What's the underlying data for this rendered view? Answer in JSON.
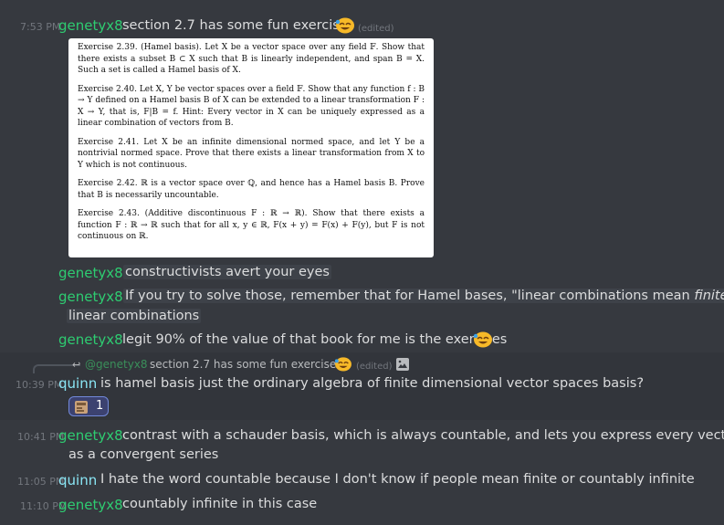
{
  "messages": [
    {
      "time": "7:53 PM",
      "author": "genetyx8",
      "text": "section 2.7 has some fun exercises",
      "edited": "(edited)"
    },
    {
      "author": "genetyx8",
      "text": "constructivists avert your eyes"
    },
    {
      "author": "genetyx8",
      "text_line1_a": "If you try to solve those, remember that for Hamel bases, \"linear combinations mean ",
      "text_line1_em": "finite",
      "text_line2": "linear combinations"
    },
    {
      "author": "genetyx8",
      "text": "legit 90% of the value of that book for me is the exercises"
    },
    {
      "time": "10:39 PM",
      "author": "quinn",
      "text": "is hamel basis just the ordinary algebra of finite dimensional vector spaces basis?"
    },
    {
      "time": "10:41 PM",
      "author": "genetyx8",
      "text_line1": "contrast with a schauder basis, which is always countable, and lets you express every vector",
      "text_line2": "as a convergent series"
    },
    {
      "time": "11:05 PM",
      "author": "quinn",
      "text": "I hate the word countable because I don't know if people mean finite or countably infinite"
    },
    {
      "time": "11:10 PM",
      "author": "genetyx8",
      "text": "countably infinite in this case"
    }
  ],
  "reply": {
    "author": "@genetyx8",
    "text": "section 2.7 has some fun exercises",
    "edited": "(edited)"
  },
  "reaction": {
    "count": "1"
  },
  "attachment": {
    "ex239": "Exercise 2.39. (Hamel basis). Let X be a vector space over any field 𝔽. Show that there exists a subset B ⊂ X such that B is linearly independent, and span B = X. Such a set is called a Hamel basis of X.",
    "ex240": "Exercise 2.40. Let X, Y be vector spaces over a field 𝔽. Show that any function f : B → Y defined on a Hamel basis B of X can be extended to a linear transformation F : X → Y, that is, F|B = f. Hint: Every vector in X can be uniquely expressed as a linear combination of vectors from B.",
    "ex241": "Exercise 2.41. Let X be an infinite dimensional normed space, and let Y be a nontrivial normed space. Prove that there exists a linear transformation from X to Y which is not continuous.",
    "ex242": "Exercise 2.42. ℝ is a vector space over ℚ, and hence has a Hamel basis B. Prove that B is necessarily uncountable.",
    "ex243": "Exercise 2.43. (Additive discontinuous F : ℝ → ℝ). Show that there exists a function F : ℝ → ℝ such that for all x, y ∈ ℝ, F(x + y) = F(x) + F(y), but F is not continuous on ℝ."
  },
  "colors": {
    "background": "#36393f",
    "genetyx8": "#2ecc71",
    "quinn": "#8ae6f5",
    "timestamp": "#72767d"
  }
}
